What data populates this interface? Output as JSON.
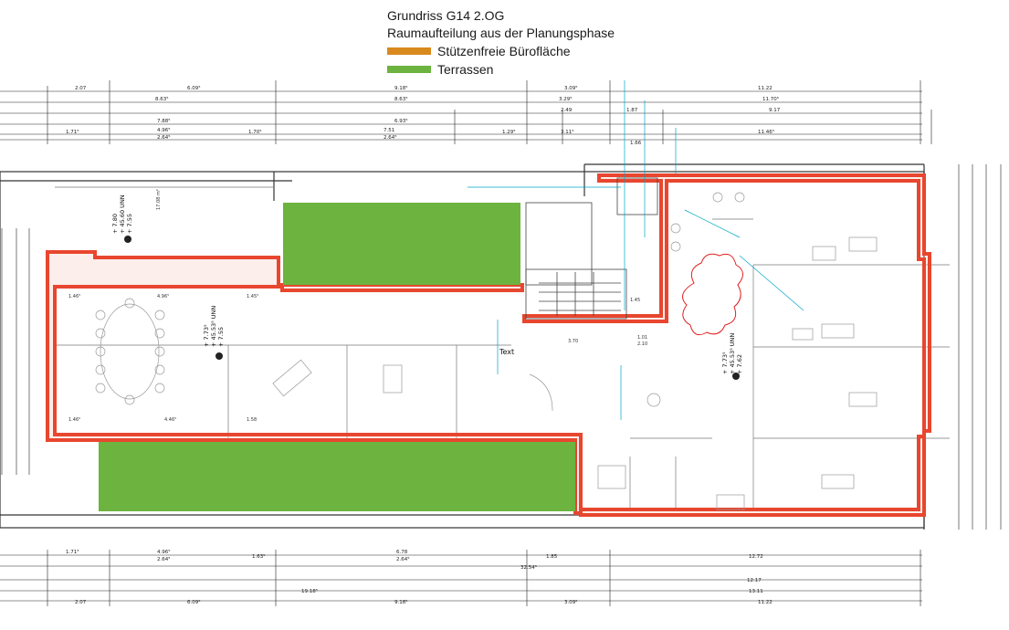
{
  "legend": {
    "title": "Grundriss G14 2.OG",
    "subtitle": "Raumaufteilung aus der Planungsphase",
    "items": [
      {
        "label": "Stützenfreie Bürofläche",
        "color": "#d98a1e"
      },
      {
        "label": "Terrassen",
        "color": "#6cb33f"
      }
    ]
  },
  "colors": {
    "office_outline": "#e8462f",
    "office_fill": "#f7cfc2",
    "terrace": "#6cb33f",
    "wall": "#333333",
    "annotation": "#00a6c8",
    "red_annotation": "#e02020"
  },
  "plan": {
    "top_dims_row1": [
      "2.07",
      "6.09⁵",
      "9.18⁵",
      "3.09⁵",
      "11.22"
    ],
    "top_dims_row2": [
      "8.63⁵",
      "8.63⁵",
      "3.29⁵",
      "11.70⁵"
    ],
    "top_dims_row3": [
      "7.88⁵",
      "6.93⁵",
      "2.49",
      "1.87",
      "9.17"
    ],
    "top_dims_row4": [
      "1.71⁵",
      "4.96⁵",
      "2.64⁵",
      "1.70⁵",
      "7.51",
      "2.64⁵",
      "1.29⁵",
      "3.11⁵",
      "1.66",
      "11.46⁵"
    ],
    "bottom_dims_row1": [
      "1.71⁵",
      "4.96⁵",
      "2.64⁵",
      "1.63⁵",
      "6.78",
      "2.64⁵",
      "1.85",
      "12.72"
    ],
    "bottom_dims_row2": [
      "32.54⁵",
      "12.17"
    ],
    "bottom_dims_row3": [
      "19.18⁵",
      "13.11"
    ],
    "bottom_dims_row4": [
      "2.07",
      "6.09⁵",
      "9.18⁵",
      "3.09⁵",
      "11.22"
    ],
    "room_area": "17.08 m²",
    "room_labels": [
      "1.46⁵",
      "4.96⁵",
      "1.45⁵",
      "1.46⁵",
      "4.46⁵",
      "1.58",
      "3.70",
      "1.01",
      "2.10",
      "1.45"
    ],
    "levels": [
      {
        "line1": "+ 7.80",
        "line2": "+ 45.60 UNN",
        "line3": "+ 7.55"
      },
      {
        "line1": "+ 7.73⁵",
        "line2": "+ 45.53⁵ UNN",
        "line3": "+ 7.55"
      },
      {
        "line1": "+ 7.73⁵",
        "line2": "+ 45.53⁵ UNN",
        "line3": "+ 7.62"
      }
    ],
    "text_marker": "Text"
  }
}
